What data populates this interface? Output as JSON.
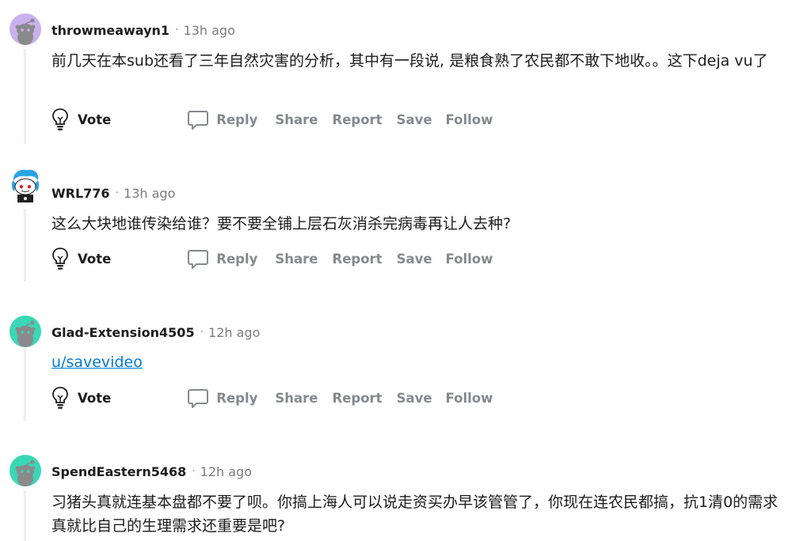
{
  "colors": {
    "avatar_purple": "#c9b1ee",
    "avatar_teal": "#3ad7b6",
    "link": "#0079d3",
    "muted": "#878a8c"
  },
  "comments": [
    {
      "username": "throwmeawayn1",
      "separator": "·",
      "time": "13h ago",
      "text": "前几天在本sub还看了三年自然灾害的分析，其中有一段说, 是粮食熟了农民都不敢下地收。。这下deja vu了",
      "avatar": "snoo-purple",
      "actions": {
        "vote": "Vote",
        "reply": "Reply",
        "share": "Share",
        "report": "Report",
        "save": "Save",
        "follow": "Follow"
      }
    },
    {
      "username": "WRL776",
      "separator": "·",
      "time": "13h ago",
      "text": "这么大块地谁传染给谁？要不要全铺上层石灰消杀完病毒再让人去种?",
      "avatar": "snoo-custom-blue-hair",
      "actions": {
        "vote": "Vote",
        "reply": "Reply",
        "share": "Share",
        "report": "Report",
        "save": "Save",
        "follow": "Follow"
      }
    },
    {
      "username": "Glad-Extension4505",
      "separator": "·",
      "time": "12h ago",
      "link_text": "u/savevideo",
      "avatar": "snoo-teal",
      "actions": {
        "vote": "Vote",
        "reply": "Reply",
        "share": "Share",
        "report": "Report",
        "save": "Save",
        "follow": "Follow"
      }
    },
    {
      "username": "SpendEastern5468",
      "separator": "·",
      "time": "12h ago",
      "text": "习猪头真就连基本盘都不要了呗。你搞上海人可以说走资买办早该管管了，你现在连农民都搞，抗1清0的需求真就比自己的生理需求还重要是吧?",
      "avatar": "snoo-teal"
    }
  ]
}
